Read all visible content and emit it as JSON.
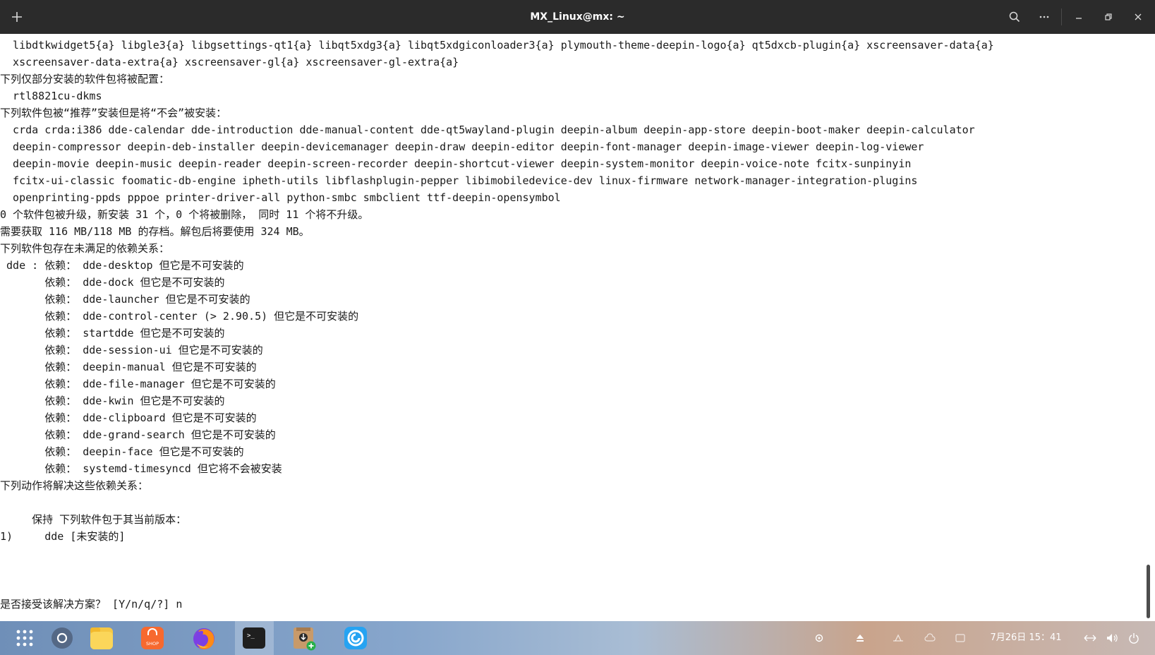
{
  "window": {
    "title": "MX_Linux@mx: ~"
  },
  "terminal": {
    "lines": [
      "  libdtkwidget5{a} libgle3{a} libgsettings-qt1{a} libqt5xdg3{a} libqt5xdgiconloader3{a} plymouth-theme-deepin-logo{a} qt5dxcb-plugin{a} xscreensaver-data{a}",
      "  xscreensaver-data-extra{a} xscreensaver-gl{a} xscreensaver-gl-extra{a}",
      "下列仅部分安装的软件包将被配置：",
      "  rtl8821cu-dkms",
      "下列软件包被“推荐”安装但是将“不会”被安装：",
      "  crda crda:i386 dde-calendar dde-introduction dde-manual-content dde-qt5wayland-plugin deepin-album deepin-app-store deepin-boot-maker deepin-calculator",
      "  deepin-compressor deepin-deb-installer deepin-devicemanager deepin-draw deepin-editor deepin-font-manager deepin-image-viewer deepin-log-viewer",
      "  deepin-movie deepin-music deepin-reader deepin-screen-recorder deepin-shortcut-viewer deepin-system-monitor deepin-voice-note fcitx-sunpinyin",
      "  fcitx-ui-classic foomatic-db-engine ipheth-utils libflashplugin-pepper libimobiledevice-dev linux-firmware network-manager-integration-plugins",
      "  openprinting-ppds pppoe printer-driver-all python-smbc smbclient ttf-deepin-opensymbol",
      "0 个软件包被升级，新安装 31 个，0 个将被删除， 同时 11 个将不升级。",
      "需要获取 116 MB/118 MB 的存档。解包后将要使用 324 MB。",
      "下列软件包存在未满足的依赖关系：",
      " dde : 依赖： dde-desktop 但它是不可安装的",
      "       依赖： dde-dock 但它是不可安装的",
      "       依赖： dde-launcher 但它是不可安装的",
      "       依赖： dde-control-center (> 2.90.5) 但它是不可安装的",
      "       依赖： startdde 但它是不可安装的",
      "       依赖： dde-session-ui 但它是不可安装的",
      "       依赖： deepin-manual 但它是不可安装的",
      "       依赖： dde-file-manager 但它是不可安装的",
      "       依赖： dde-kwin 但它是不可安装的",
      "       依赖： dde-clipboard 但它是不可安装的",
      "       依赖： dde-grand-search 但它是不可安装的",
      "       依赖： deepin-face 但它是不可安装的",
      "       依赖： systemd-timesyncd 但它将不会被安装",
      "下列动作将解决这些依赖关系：",
      "",
      "     保持 下列软件包于其当前版本：",
      "1)     dde [未安装的]",
      "",
      "",
      "",
      "是否接受该解决方案？ [Y/n/q/?] n"
    ]
  },
  "taskbar": {
    "apps": [
      {
        "name": "launcher",
        "icon": "grid-icon"
      },
      {
        "name": "multitask",
        "icon": "circle-icon"
      },
      {
        "name": "file-manager",
        "icon": "folder-icon"
      },
      {
        "name": "app-store",
        "icon": "shop-icon",
        "label": "SHOP"
      },
      {
        "name": "firefox",
        "icon": "firefox-icon"
      },
      {
        "name": "terminal",
        "icon": "terminal-icon",
        "label": ">_"
      },
      {
        "name": "package-installer",
        "icon": "package-installer-icon"
      },
      {
        "name": "browser",
        "icon": "browser-icon"
      }
    ],
    "clock": "7月26日  15：41"
  },
  "colors": {
    "titlebar": "#2b2b2b",
    "terminal_bg": "#ffffff",
    "terminal_fg": "#1a1a1a",
    "taskbar_left": "#6f8fb8",
    "taskbar_right": "#c7b9b5"
  }
}
